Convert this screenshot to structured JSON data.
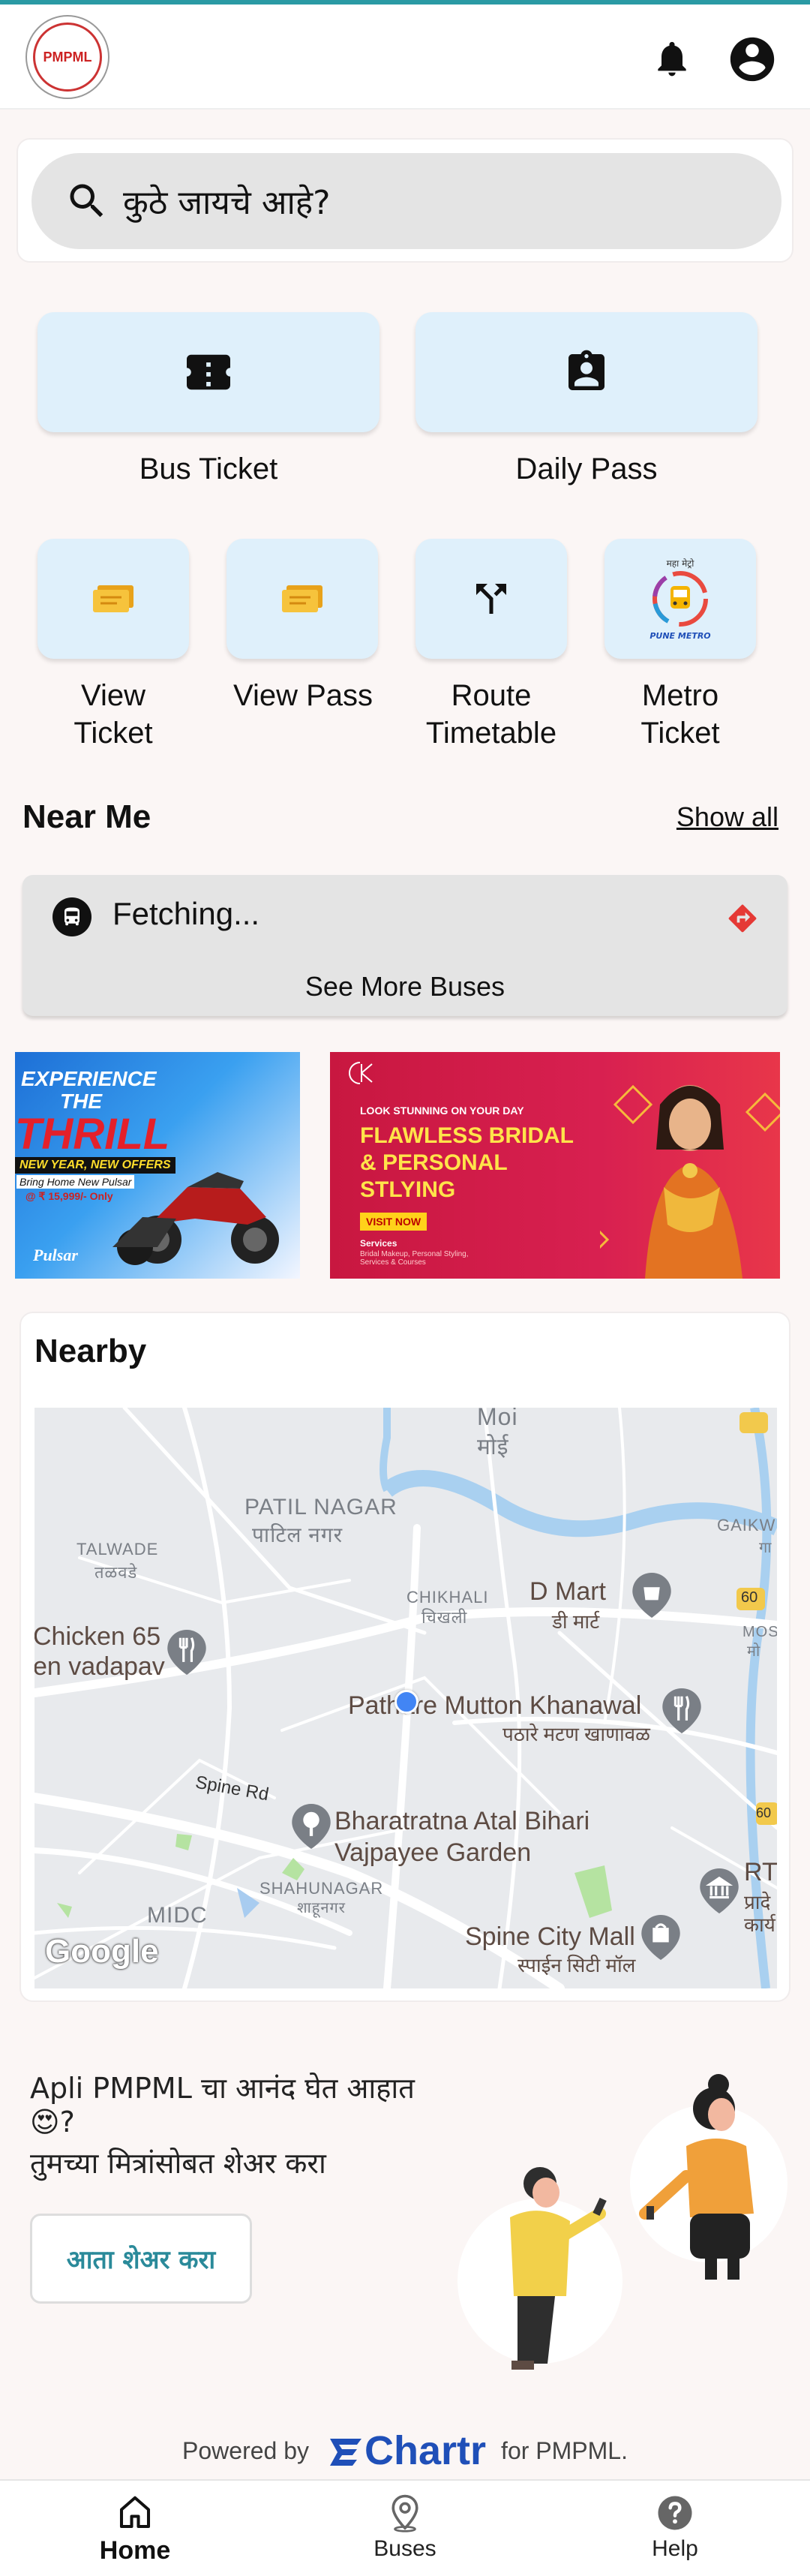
{
  "header": {
    "logo_text": "PMPML",
    "notification_icon": "bell-icon",
    "profile_icon": "account-circle-icon"
  },
  "search": {
    "placeholder": "कुठे जायचे आहे?"
  },
  "quick_actions": {
    "bus_ticket": "Bus Ticket",
    "daily_pass": "Daily Pass"
  },
  "small_actions": [
    {
      "line1": "View",
      "line2": "Ticket"
    },
    {
      "line1": "View Pass",
      "line2": ""
    },
    {
      "line1": "Route",
      "line2": "Timetable"
    },
    {
      "line1": "Metro",
      "line2": "Ticket"
    }
  ],
  "metro_logo": {
    "top": "महा मेट्रो",
    "bottom": "PUNE METRO"
  },
  "near_me": {
    "title": "Near Me",
    "show_all": "Show all",
    "status": "Fetching...",
    "see_more": "See More Buses"
  },
  "ads": {
    "ad1": {
      "line1": "EXPERIENCE",
      "line2": "THE",
      "line3": "THRILL",
      "offer": "NEW YEAR, NEW OFFERS",
      "sub": "Bring Home New Pulsar",
      "price": "@ ₹ 15,999/- Only",
      "brand": "Pulsar"
    },
    "ad2": {
      "tagline": "LOOK STUNNING ON YOUR DAY",
      "head1": "FLAWLESS BRIDAL",
      "head2": "& PERSONAL",
      "head3": "STLYING",
      "cta": "VISIT NOW",
      "services": "Services",
      "services_detail": "Bridal Makeup, Personal Styling, Services & Courses"
    }
  },
  "nearby": {
    "title": "Nearby",
    "map_labels": {
      "moi_en": "Moi",
      "moi_mr": "मोई",
      "patil_nagar_en": "PATIL NAGAR",
      "patil_nagar_mr": "पाटिल नगर",
      "talwade_en": "TALWADE",
      "talwade_mr": "तळवडे",
      "chikhali_en": "CHIKHALI",
      "chikhali_mr": "चिखली",
      "dmart_en": "D Mart",
      "dmart_mr": "डी मार्ट",
      "gaikw": "GAIKW",
      "gaikw_mr": "गा",
      "mos": "MOS",
      "mos_mr": "मो",
      "chicken_1": "Chicken 65",
      "chicken_2": "en vadapav",
      "pathare_en": "Pathare Mutton Khanawal",
      "pathare_mr": "पठारे मटण खाणावळ",
      "spine_rd": "Spine Rd",
      "garden_1": "Bharatratna Atal Bihari",
      "garden_2": "Vajpayee Garden",
      "shahunagar_en": "SHAHUNAGAR",
      "shahunagar_mr": "शाहूनगर",
      "midc": "MIDC",
      "spine_mall_en": "Spine City Mall",
      "spine_mall_mr": "स्पाईन सिटी मॉल",
      "rto": "RT",
      "rto_mr_1": "प्रादे",
      "rto_mr_2": "कार्य",
      "shield_60a": "60",
      "shield_60b": "60",
      "google": "Google"
    }
  },
  "share": {
    "line1": "Apli PMPML चा आनंद घेत आहात",
    "line2": "😍?",
    "line3": "तुमच्या मित्रांसोबत शेअर करा",
    "button": "आता शेअर करा"
  },
  "footer": {
    "powered_by": "Powered by",
    "brand": "Chartr",
    "for": "for PMPML."
  },
  "bottom_nav": {
    "home": "Home",
    "buses": "Buses",
    "help": "Help"
  },
  "colors": {
    "accent": "#2a9aa4",
    "tile_bg": "#dff0fb",
    "chartr_blue": "#1f4fb8"
  }
}
